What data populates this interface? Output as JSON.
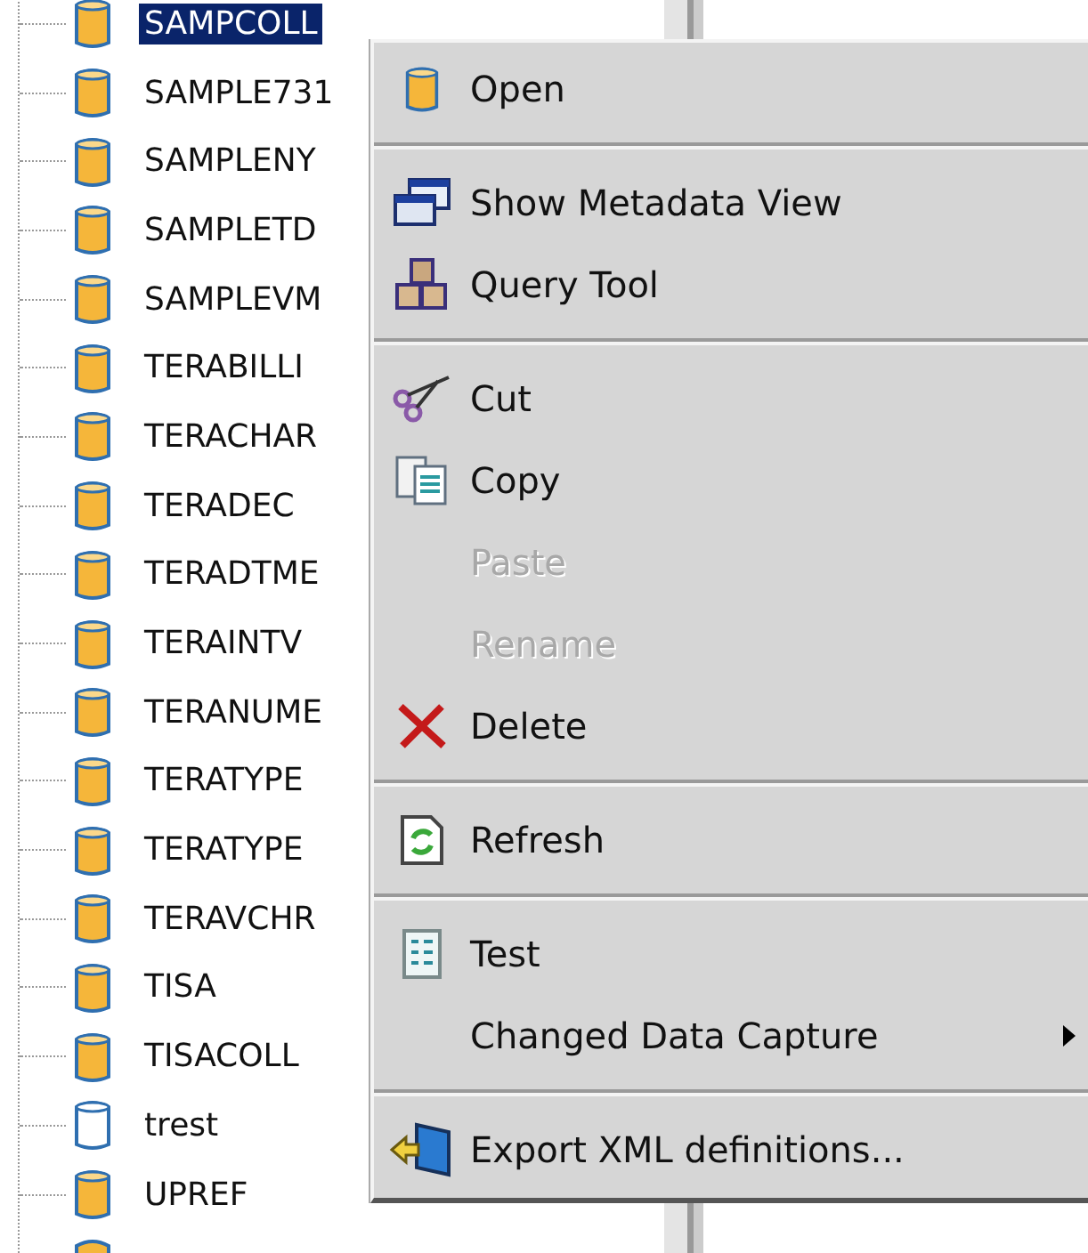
{
  "tree": {
    "items": [
      {
        "label": "SAMPCOLL",
        "selected": true,
        "populated": true
      },
      {
        "label": "SAMPLE731",
        "selected": false,
        "populated": true
      },
      {
        "label": "SAMPLENY",
        "selected": false,
        "populated": true
      },
      {
        "label": "SAMPLETD",
        "selected": false,
        "populated": true
      },
      {
        "label": "SAMPLEVM",
        "selected": false,
        "populated": true
      },
      {
        "label": "TERABILLI",
        "selected": false,
        "populated": true
      },
      {
        "label": "TERACHAR",
        "selected": false,
        "populated": true
      },
      {
        "label": "TERADEC",
        "selected": false,
        "populated": true
      },
      {
        "label": "TERADTME",
        "selected": false,
        "populated": true
      },
      {
        "label": "TERAINTV",
        "selected": false,
        "populated": true
      },
      {
        "label": "TERANUME",
        "selected": false,
        "populated": true
      },
      {
        "label": "TERATYPE",
        "selected": false,
        "populated": true
      },
      {
        "label": "TERATYPE",
        "selected": false,
        "populated": true
      },
      {
        "label": "TERAVCHR",
        "selected": false,
        "populated": true
      },
      {
        "label": "TISA",
        "selected": false,
        "populated": true
      },
      {
        "label": "TISACOLL",
        "selected": false,
        "populated": true
      },
      {
        "label": "trest",
        "selected": false,
        "populated": false
      },
      {
        "label": "UPREF",
        "selected": false,
        "populated": true
      }
    ]
  },
  "context_menu": {
    "items": [
      {
        "kind": "item",
        "label": "Open",
        "disabled": false,
        "submenu": false
      },
      {
        "kind": "separator"
      },
      {
        "kind": "item",
        "label": "Show Metadata View",
        "disabled": false,
        "submenu": false
      },
      {
        "kind": "item",
        "label": "Query Tool",
        "disabled": false,
        "submenu": false
      },
      {
        "kind": "separator"
      },
      {
        "kind": "item",
        "label": "Cut",
        "disabled": false,
        "submenu": false
      },
      {
        "kind": "item",
        "label": "Copy",
        "disabled": false,
        "submenu": false
      },
      {
        "kind": "item",
        "label": "Paste",
        "disabled": true,
        "submenu": false
      },
      {
        "kind": "item",
        "label": "Rename",
        "disabled": true,
        "submenu": false
      },
      {
        "kind": "item",
        "label": "Delete",
        "disabled": false,
        "submenu": false
      },
      {
        "kind": "separator"
      },
      {
        "kind": "item",
        "label": "Refresh",
        "disabled": false,
        "submenu": false
      },
      {
        "kind": "separator"
      },
      {
        "kind": "item",
        "label": "Test",
        "disabled": false,
        "submenu": false
      },
      {
        "kind": "item",
        "label": "Changed Data Capture",
        "disabled": false,
        "submenu": true
      },
      {
        "kind": "separator"
      },
      {
        "kind": "item",
        "label": "Export XML definitions...",
        "disabled": false,
        "submenu": false
      }
    ]
  }
}
